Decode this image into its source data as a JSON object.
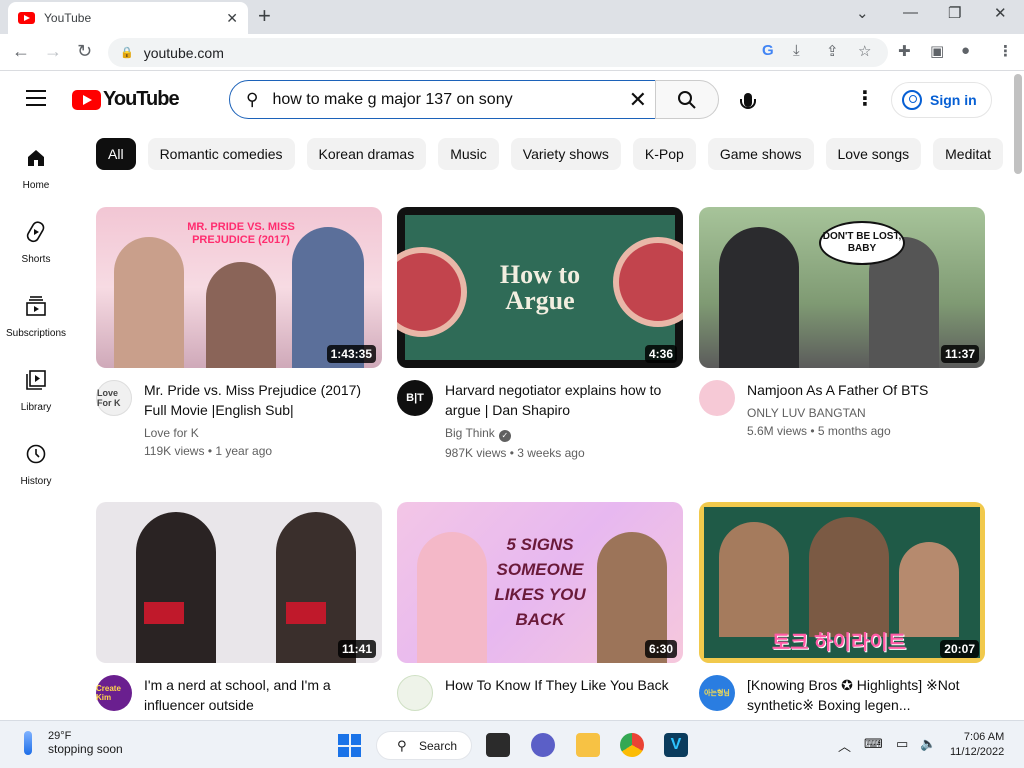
{
  "browser": {
    "tab_title": "YouTube",
    "new_tab_label": "+",
    "url": "youtube.com",
    "window_controls": {
      "minimize": "—",
      "restore": "❐",
      "close": "✕",
      "dropdown": "⌄"
    }
  },
  "youtube": {
    "logo_text": "YouTube",
    "search": {
      "query": "how to make g major 137 on sony",
      "clear_icon": "✕"
    },
    "signin_label": "Sign in",
    "chips": [
      "All",
      "Romantic comedies",
      "Korean dramas",
      "Music",
      "Variety shows",
      "K-Pop",
      "Game shows",
      "Love songs",
      "Meditat"
    ],
    "guide": [
      {
        "label": "Home",
        "icon": "home-icon"
      },
      {
        "label": "Shorts",
        "icon": "shorts-icon"
      },
      {
        "label": "Subscriptions",
        "icon": "subscriptions-icon"
      },
      {
        "label": "Library",
        "icon": "library-icon"
      },
      {
        "label": "History",
        "icon": "history-icon"
      }
    ],
    "videos": [
      {
        "title": "Mr. Pride vs. Miss Prejudice (2017) Full Movie |English Sub|",
        "channel": "Love for K",
        "views": "119K views",
        "age": "1 year ago",
        "duration": "1:43:35",
        "thumb_text": "MR. PRIDE VS. MISS PREJUDICE (2017)",
        "avatar_text": "Love For K",
        "verified": false
      },
      {
        "title": "Harvard negotiator explains how to argue | Dan Shapiro",
        "channel": "Big Think",
        "views": "987K views",
        "age": "3 weeks ago",
        "duration": "4:36",
        "thumb_text": "How to Argue",
        "avatar_text": "B|T",
        "verified": true
      },
      {
        "title": "Namjoon As A Father Of BTS",
        "channel": "ONLY LUV BANGTAN",
        "views": "5.6M views",
        "age": "5 months ago",
        "duration": "11:37",
        "thumb_text": "DON'T BE LOST, BABY",
        "avatar_text": "",
        "verified": false
      },
      {
        "title": "I'm a nerd at school, and I'm a influencer outside",
        "channel": "",
        "views": "",
        "age": "",
        "duration": "11:41",
        "thumb_text": "",
        "avatar_text": "Create Kim",
        "verified": false
      },
      {
        "title": "How To Know If They Like You Back",
        "channel": "",
        "views": "",
        "age": "",
        "duration": "6:30",
        "thumb_text": "5 SIGNS SOMEONE LIKES YOU BACK",
        "avatar_text": "",
        "verified": false
      },
      {
        "title": "[Knowing Bros ✪ Highlights] ※Not synthetic※ Boxing legen...",
        "channel": "",
        "views": "",
        "age": "",
        "duration": "20:07",
        "thumb_text": "토크 하이라이트",
        "avatar_text": "아는형님",
        "verified": false
      }
    ]
  },
  "taskbar": {
    "weather_temp": "29°F",
    "weather_desc": "stopping soon",
    "search_label": "Search",
    "time": "7:06 AM",
    "date": "11/12/2022"
  },
  "colors": {
    "youtube_red": "#ff0000",
    "link_blue": "#065fd4",
    "chip_bg": "#f2f2f2",
    "search_focus": "#1c62b9"
  }
}
